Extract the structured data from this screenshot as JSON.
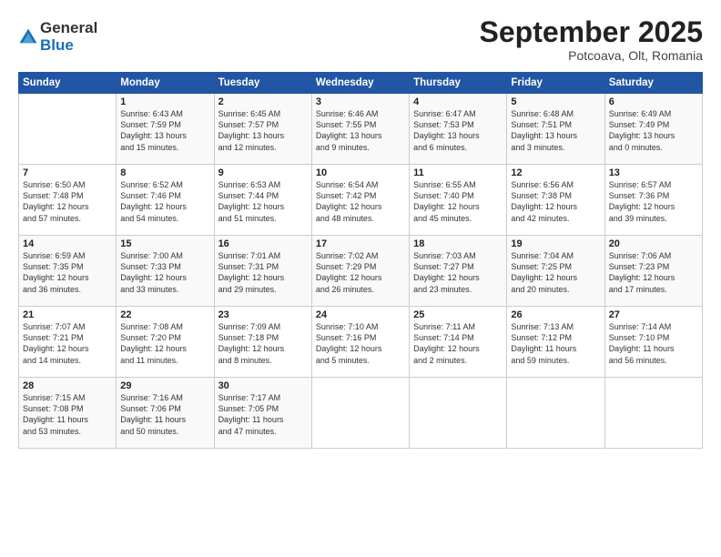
{
  "header": {
    "logo_general": "General",
    "logo_blue": "Blue",
    "month_title": "September 2025",
    "location": "Potcoava, Olt, Romania"
  },
  "weekdays": [
    "Sunday",
    "Monday",
    "Tuesday",
    "Wednesday",
    "Thursday",
    "Friday",
    "Saturday"
  ],
  "weeks": [
    [
      {
        "day": "",
        "info": ""
      },
      {
        "day": "1",
        "info": "Sunrise: 6:43 AM\nSunset: 7:59 PM\nDaylight: 13 hours\nand 15 minutes."
      },
      {
        "day": "2",
        "info": "Sunrise: 6:45 AM\nSunset: 7:57 PM\nDaylight: 13 hours\nand 12 minutes."
      },
      {
        "day": "3",
        "info": "Sunrise: 6:46 AM\nSunset: 7:55 PM\nDaylight: 13 hours\nand 9 minutes."
      },
      {
        "day": "4",
        "info": "Sunrise: 6:47 AM\nSunset: 7:53 PM\nDaylight: 13 hours\nand 6 minutes."
      },
      {
        "day": "5",
        "info": "Sunrise: 6:48 AM\nSunset: 7:51 PM\nDaylight: 13 hours\nand 3 minutes."
      },
      {
        "day": "6",
        "info": "Sunrise: 6:49 AM\nSunset: 7:49 PM\nDaylight: 13 hours\nand 0 minutes."
      }
    ],
    [
      {
        "day": "7",
        "info": "Sunrise: 6:50 AM\nSunset: 7:48 PM\nDaylight: 12 hours\nand 57 minutes."
      },
      {
        "day": "8",
        "info": "Sunrise: 6:52 AM\nSunset: 7:46 PM\nDaylight: 12 hours\nand 54 minutes."
      },
      {
        "day": "9",
        "info": "Sunrise: 6:53 AM\nSunset: 7:44 PM\nDaylight: 12 hours\nand 51 minutes."
      },
      {
        "day": "10",
        "info": "Sunrise: 6:54 AM\nSunset: 7:42 PM\nDaylight: 12 hours\nand 48 minutes."
      },
      {
        "day": "11",
        "info": "Sunrise: 6:55 AM\nSunset: 7:40 PM\nDaylight: 12 hours\nand 45 minutes."
      },
      {
        "day": "12",
        "info": "Sunrise: 6:56 AM\nSunset: 7:38 PM\nDaylight: 12 hours\nand 42 minutes."
      },
      {
        "day": "13",
        "info": "Sunrise: 6:57 AM\nSunset: 7:36 PM\nDaylight: 12 hours\nand 39 minutes."
      }
    ],
    [
      {
        "day": "14",
        "info": "Sunrise: 6:59 AM\nSunset: 7:35 PM\nDaylight: 12 hours\nand 36 minutes."
      },
      {
        "day": "15",
        "info": "Sunrise: 7:00 AM\nSunset: 7:33 PM\nDaylight: 12 hours\nand 33 minutes."
      },
      {
        "day": "16",
        "info": "Sunrise: 7:01 AM\nSunset: 7:31 PM\nDaylight: 12 hours\nand 29 minutes."
      },
      {
        "day": "17",
        "info": "Sunrise: 7:02 AM\nSunset: 7:29 PM\nDaylight: 12 hours\nand 26 minutes."
      },
      {
        "day": "18",
        "info": "Sunrise: 7:03 AM\nSunset: 7:27 PM\nDaylight: 12 hours\nand 23 minutes."
      },
      {
        "day": "19",
        "info": "Sunrise: 7:04 AM\nSunset: 7:25 PM\nDaylight: 12 hours\nand 20 minutes."
      },
      {
        "day": "20",
        "info": "Sunrise: 7:06 AM\nSunset: 7:23 PM\nDaylight: 12 hours\nand 17 minutes."
      }
    ],
    [
      {
        "day": "21",
        "info": "Sunrise: 7:07 AM\nSunset: 7:21 PM\nDaylight: 12 hours\nand 14 minutes."
      },
      {
        "day": "22",
        "info": "Sunrise: 7:08 AM\nSunset: 7:20 PM\nDaylight: 12 hours\nand 11 minutes."
      },
      {
        "day": "23",
        "info": "Sunrise: 7:09 AM\nSunset: 7:18 PM\nDaylight: 12 hours\nand 8 minutes."
      },
      {
        "day": "24",
        "info": "Sunrise: 7:10 AM\nSunset: 7:16 PM\nDaylight: 12 hours\nand 5 minutes."
      },
      {
        "day": "25",
        "info": "Sunrise: 7:11 AM\nSunset: 7:14 PM\nDaylight: 12 hours\nand 2 minutes."
      },
      {
        "day": "26",
        "info": "Sunrise: 7:13 AM\nSunset: 7:12 PM\nDaylight: 11 hours\nand 59 minutes."
      },
      {
        "day": "27",
        "info": "Sunrise: 7:14 AM\nSunset: 7:10 PM\nDaylight: 11 hours\nand 56 minutes."
      }
    ],
    [
      {
        "day": "28",
        "info": "Sunrise: 7:15 AM\nSunset: 7:08 PM\nDaylight: 11 hours\nand 53 minutes."
      },
      {
        "day": "29",
        "info": "Sunrise: 7:16 AM\nSunset: 7:06 PM\nDaylight: 11 hours\nand 50 minutes."
      },
      {
        "day": "30",
        "info": "Sunrise: 7:17 AM\nSunset: 7:05 PM\nDaylight: 11 hours\nand 47 minutes."
      },
      {
        "day": "",
        "info": ""
      },
      {
        "day": "",
        "info": ""
      },
      {
        "day": "",
        "info": ""
      },
      {
        "day": "",
        "info": ""
      }
    ]
  ]
}
